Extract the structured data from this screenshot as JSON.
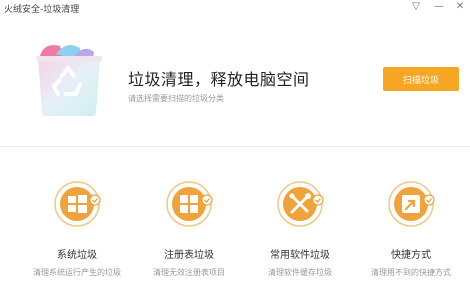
{
  "window": {
    "title": "火绒安全-垃圾清理",
    "menu_glyph": "▽",
    "minimize_glyph": "—",
    "close_glyph": "✕"
  },
  "hero": {
    "title": "垃圾清理，释放电脑空间",
    "subtitle": "请选择需要扫描的垃圾分类",
    "scan_button": "扫描垃圾"
  },
  "colors": {
    "accent": "#f5a623",
    "icon_orange": "#f0a33a",
    "check_blue": "#f0a33a"
  },
  "categories": [
    {
      "name": "系统垃圾",
      "desc": "清理系统运行产生的垃圾",
      "icon": "windows-icon",
      "checked": true
    },
    {
      "name": "注册表垃圾",
      "desc": "清理无效注册表项目",
      "icon": "registry-icon",
      "checked": true
    },
    {
      "name": "常用软件垃圾",
      "desc": "清理软件缓存垃圾",
      "icon": "tools-icon",
      "checked": true
    },
    {
      "name": "快捷方式",
      "desc": "清理用不到的快捷方式",
      "icon": "shortcut-icon",
      "checked": true
    }
  ]
}
